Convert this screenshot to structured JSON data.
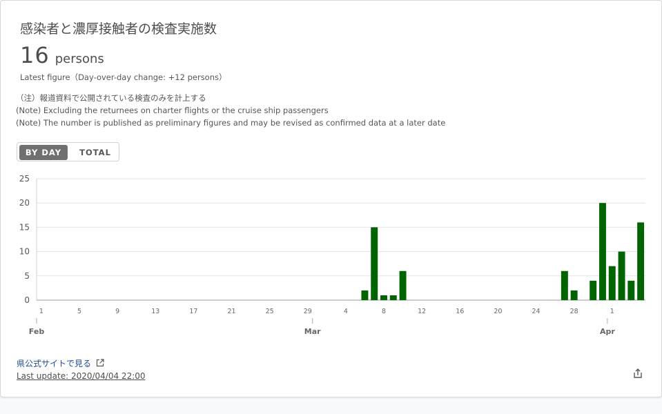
{
  "card": {
    "title": "感染者と濃厚接触者の検査実施数",
    "value": "16",
    "unit": "persons",
    "latest": "Latest figure（Day-over-day change: +12 persons）",
    "notes": [
      "（注）報道資料で公開されている検査のみを計上する",
      "(Note) Excluding the returnees on charter flights or the cruise ship passengers",
      "(Note) The number is published as preliminary figures and may be revised as confirmed data at a later date"
    ],
    "toggle": {
      "by_day": "BY DAY",
      "total": "TOTAL",
      "selected": "BY DAY"
    },
    "link_text": "県公式サイトで見る",
    "last_update": "Last update: 2020/04/04 22:00"
  },
  "icons": {
    "external": "external-link-icon",
    "share": "share-icon"
  },
  "colors": {
    "bar": "#006400",
    "text": "#4d4d4d",
    "link": "#1b4d8f"
  },
  "chart_data": {
    "type": "bar",
    "ylim": [
      0,
      25
    ],
    "yticks": [
      "0",
      "5",
      "10",
      "15",
      "20",
      "25"
    ],
    "x": [
      "2/1",
      "2/2",
      "2/3",
      "2/4",
      "2/5",
      "2/6",
      "2/7",
      "2/8",
      "2/9",
      "2/10",
      "2/11",
      "2/12",
      "2/13",
      "2/14",
      "2/15",
      "2/16",
      "2/17",
      "2/18",
      "2/19",
      "2/20",
      "2/21",
      "2/22",
      "2/23",
      "2/24",
      "2/25",
      "2/26",
      "2/27",
      "2/28",
      "2/29",
      "3/1",
      "3/2",
      "3/3",
      "3/4",
      "3/5",
      "3/6",
      "3/7",
      "3/8",
      "3/9",
      "3/10",
      "3/11",
      "3/12",
      "3/13",
      "3/14",
      "3/15",
      "3/16",
      "3/17",
      "3/18",
      "3/19",
      "3/20",
      "3/21",
      "3/22",
      "3/23",
      "3/24",
      "3/25",
      "3/26",
      "3/27",
      "3/28",
      "3/29",
      "3/30",
      "3/31",
      "4/1",
      "4/2",
      "4/3",
      "4/4"
    ],
    "values": [
      0,
      0,
      0,
      0,
      0,
      0,
      0,
      0,
      0,
      0,
      0,
      0,
      0,
      0,
      0,
      0,
      0,
      0,
      0,
      0,
      0,
      0,
      0,
      0,
      0,
      0,
      0,
      0,
      0,
      0,
      0,
      0,
      0,
      0,
      2,
      15,
      1,
      1,
      6,
      0,
      0,
      0,
      0,
      0,
      0,
      0,
      0,
      0,
      0,
      0,
      0,
      0,
      0,
      0,
      0,
      6,
      2,
      0,
      4,
      20,
      7,
      10,
      4,
      16
    ],
    "day_ticks": [
      {
        "index": 0,
        "label": "1"
      },
      {
        "index": 4,
        "label": "5"
      },
      {
        "index": 8,
        "label": "9"
      },
      {
        "index": 12,
        "label": "13"
      },
      {
        "index": 16,
        "label": "17"
      },
      {
        "index": 20,
        "label": "21"
      },
      {
        "index": 24,
        "label": "25"
      },
      {
        "index": 28,
        "label": "29"
      },
      {
        "index": 32,
        "label": "4"
      },
      {
        "index": 36,
        "label": "8"
      },
      {
        "index": 40,
        "label": "12"
      },
      {
        "index": 44,
        "label": "16"
      },
      {
        "index": 48,
        "label": "20"
      },
      {
        "index": 52,
        "label": "24"
      },
      {
        "index": 56,
        "label": "28"
      },
      {
        "index": 60,
        "label": "1"
      }
    ],
    "month_ticks": [
      {
        "index": 0,
        "label": "Feb"
      },
      {
        "index": 29,
        "label": "Mar"
      },
      {
        "index": 60,
        "label": "Apr"
      }
    ],
    "grid": true,
    "legend": "none"
  }
}
